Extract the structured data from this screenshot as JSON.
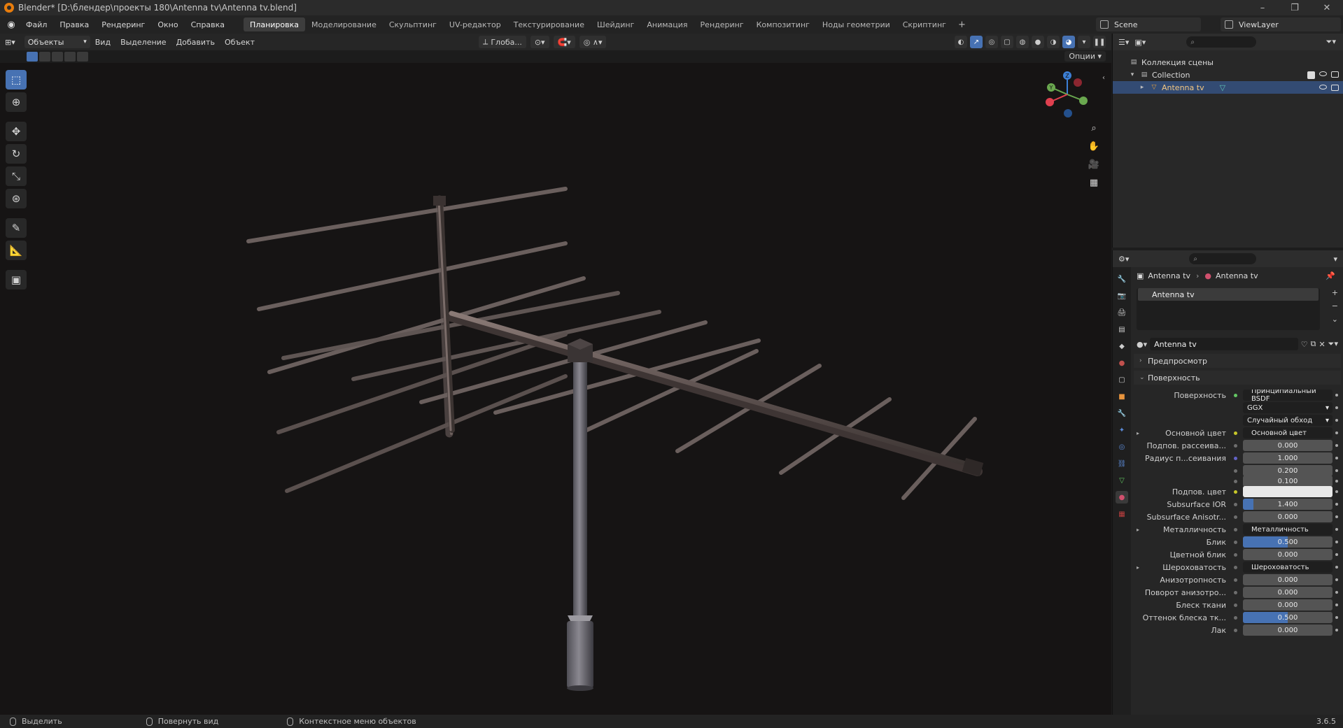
{
  "window": {
    "title": "Blender* [D:\\блендер\\проекты 180\\Antenna tv\\Antenna tv.blend]",
    "controls": [
      "–",
      "❐",
      "✕"
    ]
  },
  "menu": {
    "items": [
      "Файл",
      "Правка",
      "Рендеринг",
      "Окно",
      "Справка"
    ]
  },
  "workspaces": {
    "active": "Планировка",
    "tabs": [
      "Планировка",
      "Моделирование",
      "Скульптинг",
      "UV-редактор",
      "Текстурирование",
      "Шейдинг",
      "Анимация",
      "Рендеринг",
      "Композитинг",
      "Ноды геометрии",
      "Скриптинг"
    ],
    "add": "+"
  },
  "scene": {
    "name": "Scene"
  },
  "view_layer": {
    "name": "ViewLayer"
  },
  "viewport_header": {
    "mode": "Объекты",
    "menus": [
      "Вид",
      "Выделение",
      "Добавить",
      "Объект"
    ],
    "orientation": "Глоба...",
    "options": "Опции"
  },
  "outliner": {
    "rows": [
      {
        "label": "Коллекция сцены",
        "indent": 0
      },
      {
        "label": "Collection",
        "indent": 1
      },
      {
        "label": "Antenna tv",
        "indent": 2,
        "selected": true
      }
    ]
  },
  "properties": {
    "breadcrumb": {
      "object": "Antenna tv",
      "material": "Antenna tv"
    },
    "slot_name": "Antenna tv",
    "material_name": "Antenna tv",
    "panels": {
      "preview": "Предпросмотр",
      "surface": "Поверхность"
    },
    "rows": [
      {
        "label": "Поверхность",
        "value": "Принципиальный BSDF",
        "kind": "link",
        "dot": "g"
      },
      {
        "label": "",
        "value": "GGX",
        "kind": "dark",
        "dot": ""
      },
      {
        "label": "",
        "value": "Случайный обход",
        "kind": "dark",
        "dot": ""
      },
      {
        "label": "Основной цвет",
        "value": "Основной цвет",
        "kind": "link",
        "dot": "y",
        "expand": true
      },
      {
        "label": "Подпов. рассеива...",
        "value": "0.000",
        "kind": "num",
        "dot": ""
      },
      {
        "label": "Радиус п...сеивания",
        "value": "1.000",
        "kind": "num",
        "dot": "b"
      },
      {
        "label": "",
        "value": "0.200",
        "kind": "num",
        "dot": ""
      },
      {
        "label": "",
        "value": "0.100",
        "kind": "num",
        "dot": ""
      },
      {
        "label": "Подпов. цвет",
        "value": "",
        "kind": "white",
        "dot": "y"
      },
      {
        "label": "Subsurface IOR",
        "value": "1.400",
        "kind": "num",
        "dot": "",
        "fill": 0.12
      },
      {
        "label": "Subsurface Anisotr...",
        "value": "0.000",
        "kind": "num",
        "dot": ""
      },
      {
        "label": "Металличность",
        "value": "Металличность",
        "kind": "link",
        "dot": "",
        "expand": true
      },
      {
        "label": "Блик",
        "value": "0.500",
        "kind": "num",
        "dot": "",
        "fill": 0.5
      },
      {
        "label": "Цветной блик",
        "value": "0.000",
        "kind": "num",
        "dot": ""
      },
      {
        "label": "Шероховатость",
        "value": "Шероховатость",
        "kind": "link",
        "dot": "",
        "expand": true
      },
      {
        "label": "Анизотропность",
        "value": "0.000",
        "kind": "num",
        "dot": ""
      },
      {
        "label": "Поворот анизотро...",
        "value": "0.000",
        "kind": "num",
        "dot": ""
      },
      {
        "label": "Блеск ткани",
        "value": "0.000",
        "kind": "num",
        "dot": ""
      },
      {
        "label": "Оттенок блеска тк...",
        "value": "0.500",
        "kind": "num",
        "dot": "",
        "fill": 0.5
      },
      {
        "label": "Лак",
        "value": "0.000",
        "kind": "num",
        "dot": ""
      }
    ]
  },
  "statusbar": {
    "hints": [
      "Выделить",
      "Повернуть вид",
      "Контекстное меню объектов"
    ],
    "version": "3.6.5"
  },
  "gizmo": {
    "x_label": "X",
    "y_label": "Y",
    "z_label": "Z"
  },
  "colors": {
    "accent": "#4772b3",
    "axis_x": "#e0404f",
    "axis_y": "#6aa84f",
    "axis_z": "#3c7fd6"
  }
}
